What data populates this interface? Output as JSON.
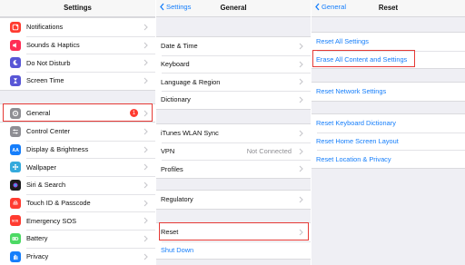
{
  "colors": {
    "accent": "#157efb",
    "highlight": "#e53935",
    "badge": "#ff3b30"
  },
  "left": {
    "title": "Settings",
    "group1": [
      {
        "label": "Notifications",
        "icon": "notifications-icon",
        "color": "#ff3b30"
      },
      {
        "label": "Sounds & Haptics",
        "icon": "speaker-icon",
        "color": "#ff2d55"
      },
      {
        "label": "Do Not Disturb",
        "icon": "moon-icon",
        "color": "#5856d6"
      },
      {
        "label": "Screen Time",
        "icon": "hourglass-icon",
        "color": "#5856d6"
      }
    ],
    "general": {
      "label": "General",
      "icon": "gear-icon",
      "color": "#8e8e93",
      "badge": "1"
    },
    "group2": [
      {
        "label": "Control Center",
        "icon": "sliders-icon",
        "color": "#8e8e93"
      },
      {
        "label": "Display & Brightness",
        "icon": "text-size-icon",
        "color": "#157efb"
      },
      {
        "label": "Wallpaper",
        "icon": "flower-icon",
        "color": "#34aadc"
      },
      {
        "label": "Siri & Search",
        "icon": "siri-icon",
        "color": "#1c1c1e"
      },
      {
        "label": "Touch ID & Passcode",
        "icon": "fingerprint-icon",
        "color": "#ff3b30"
      },
      {
        "label": "Emergency SOS",
        "icon": "sos-icon",
        "color": "#ff3b30"
      },
      {
        "label": "Battery",
        "icon": "battery-icon",
        "color": "#4cd964"
      },
      {
        "label": "Privacy",
        "icon": "hand-icon",
        "color": "#157efb"
      }
    ]
  },
  "middle": {
    "back": "Settings",
    "title": "General",
    "group1": [
      {
        "label": "Date & Time"
      },
      {
        "label": "Keyboard"
      },
      {
        "label": "Language & Region"
      },
      {
        "label": "Dictionary"
      }
    ],
    "group2": [
      {
        "label": "iTunes WLAN Sync",
        "value": ""
      },
      {
        "label": "VPN",
        "value": "Not Connected"
      },
      {
        "label": "Profiles",
        "value": ""
      }
    ],
    "regulatory": "Regulatory",
    "reset": "Reset",
    "shutdown": "Shut Down"
  },
  "right": {
    "back": "General",
    "title": "Reset",
    "items": [
      "Reset All Settings",
      "Erase All Content and Settings",
      "Reset Network Settings",
      "Reset Keyboard Dictionary",
      "Reset Home Screen Layout",
      "Reset Location & Privacy"
    ]
  }
}
